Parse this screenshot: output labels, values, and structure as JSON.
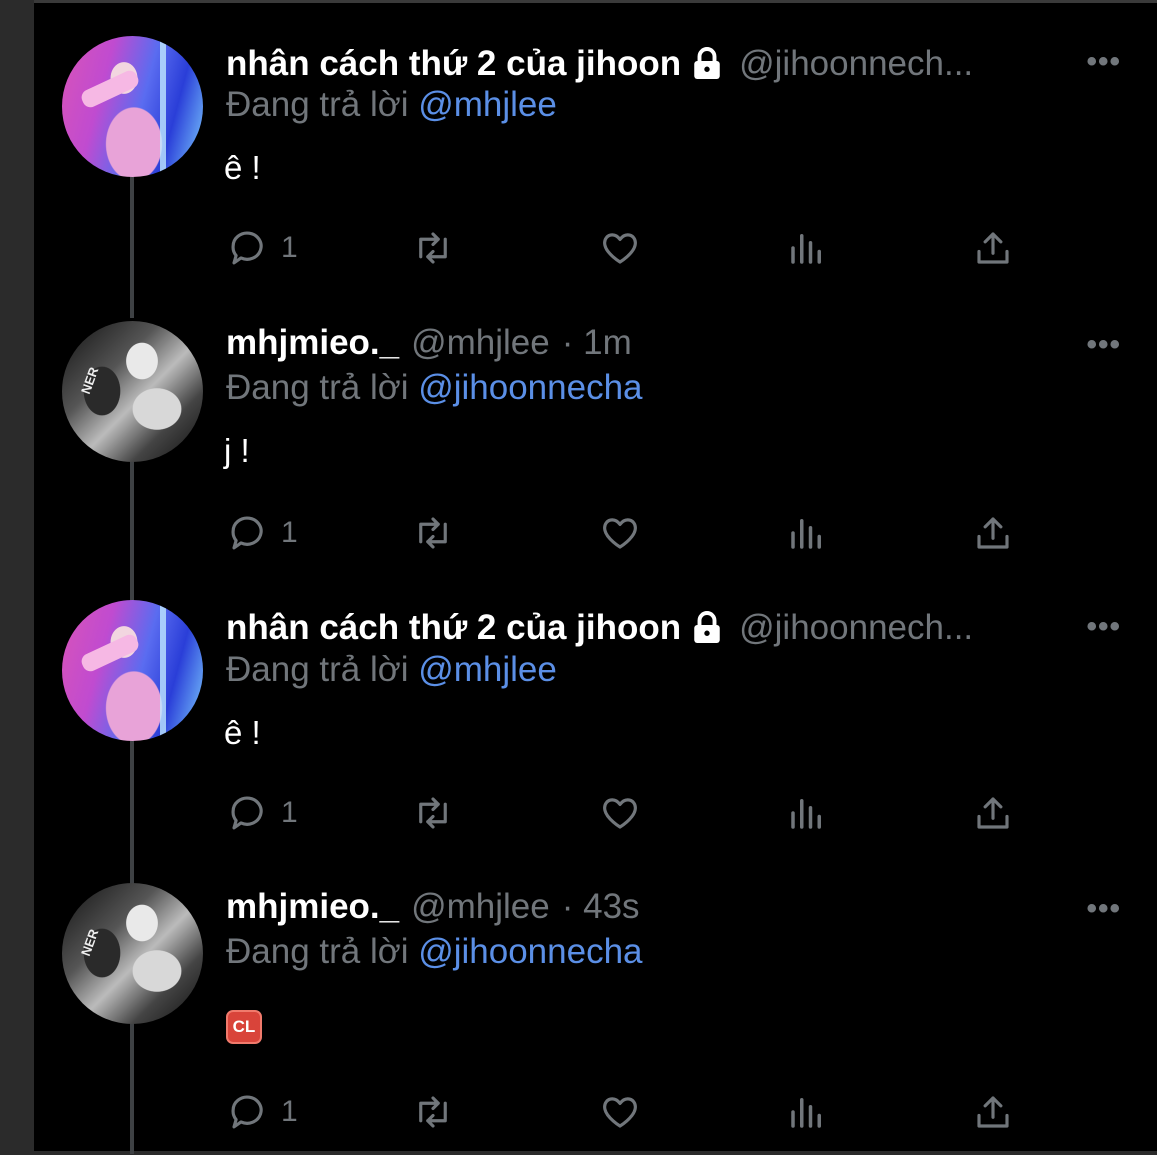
{
  "accounts": {
    "jihoon": {
      "display_name": "nhân cách thứ 2 của jihoon",
      "handle": "@jihoonnech...",
      "protected": true
    },
    "mhj": {
      "display_name": "mhjmieo._",
      "handle": "@mhjlee"
    }
  },
  "reply_prefix": "Đang trả lời",
  "tweets": [
    {
      "name": "nhân cách thứ 2 của jihoon",
      "handle": "@jihoonnech...",
      "time": "",
      "reply_to": "@mhjlee",
      "text": "ê !",
      "reply_count": "1"
    },
    {
      "name": "mhjmieo._",
      "handle": "@mhjlee",
      "time": "· 1m",
      "reply_to": "@jihoonnecha",
      "text": "j !",
      "reply_count": "1"
    },
    {
      "name": "nhân cách thứ 2 của jihoon",
      "handle": "@jihoonnech...",
      "time": "",
      "reply_to": "@mhjlee",
      "text": "ê !",
      "reply_count": "1"
    },
    {
      "name": "mhjmieo._",
      "handle": "@mhjlee",
      "time": "· 43s",
      "reply_to": "@jihoonnecha",
      "text": "",
      "emoji": "CL",
      "reply_count": "1"
    }
  ],
  "more_label": "•••",
  "icons": {
    "reply": "reply-icon",
    "retweet": "retweet-icon",
    "like": "heart-icon",
    "views": "views-icon",
    "share": "share-icon",
    "lock": "lock-icon",
    "more": "more-icon"
  },
  "colors": {
    "background": "#000000",
    "text_primary": "#ffffff",
    "text_secondary": "#71767b",
    "mention": "#5b8fe6",
    "thread_line": "#3e4144"
  }
}
